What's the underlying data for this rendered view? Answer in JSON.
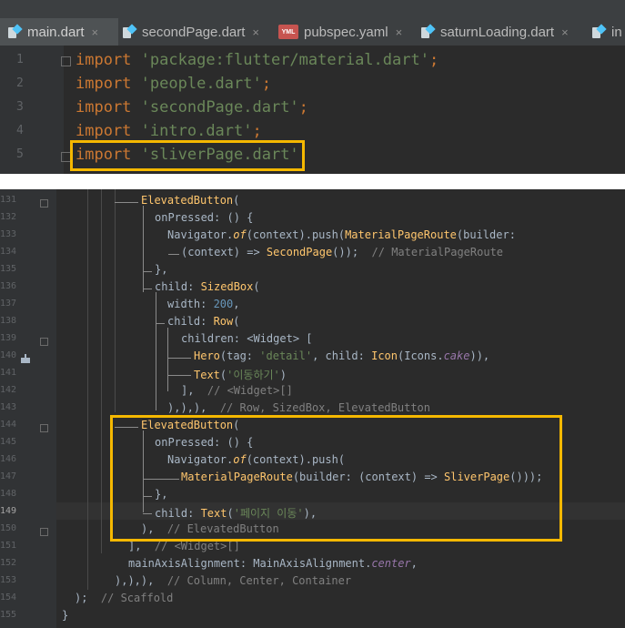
{
  "tabs": [
    {
      "label": "main.dart",
      "icon": "dart-file-icon",
      "active": true
    },
    {
      "label": "secondPage.dart",
      "icon": "dart-file-icon",
      "active": false
    },
    {
      "label": "pubspec.yaml",
      "icon": "yaml-file-icon",
      "badge": "YML",
      "active": false
    },
    {
      "label": "saturnLoading.dart",
      "icon": "dart-file-icon",
      "active": false
    },
    {
      "label": "in",
      "icon": "dart-file-icon",
      "active": false
    }
  ],
  "close_glyph": "×",
  "editor_top": {
    "line_numbers": [
      "1",
      "2",
      "3",
      "4",
      "5"
    ],
    "lines": [
      {
        "kw": "import",
        "str": "'package:flutter/material.dart'",
        "end": ";"
      },
      {
        "kw": "import",
        "str": "'people.dart'",
        "end": ";"
      },
      {
        "kw": "import",
        "str": "'secondPage.dart'",
        "end": ";"
      },
      {
        "kw": "import",
        "str": "'intro.dart'",
        "end": ";"
      },
      {
        "kw": "import",
        "str": "'sliverPage.dart'",
        "end": ";"
      }
    ]
  },
  "editor_bottom": {
    "line_numbers": [
      "131",
      "132",
      "133",
      "134",
      "135",
      "136",
      "137",
      "138",
      "139",
      "140",
      "141",
      "142",
      "143",
      "144",
      "145",
      "146",
      "147",
      "148",
      "149",
      "150",
      "151",
      "152",
      "153",
      "154",
      "155"
    ],
    "lines": {
      "l131": {
        "a": "ElevatedButton",
        "b": "("
      },
      "l132": {
        "a": "onPressed: () {"
      },
      "l133": {
        "a": "Navigator.",
        "b": "of",
        "c": "(context).push(",
        "d": "MaterialPageRoute",
        "e": "(builder:"
      },
      "l134": {
        "a": "(context) => ",
        "b": "SecondPage",
        "c": "());",
        "d": "// MaterialPageRoute"
      },
      "l135": {
        "a": "},"
      },
      "l136": {
        "a": "child: ",
        "b": "SizedBox",
        "c": "("
      },
      "l137": {
        "a": "width: ",
        "b": "200",
        "c": ","
      },
      "l138": {
        "a": "child: ",
        "b": "Row",
        "c": "("
      },
      "l139": {
        "a": "children: <Widget> ["
      },
      "l140": {
        "a": "Hero",
        "b": "(tag: ",
        "c": "'detail'",
        "d": ", child: ",
        "e": "Icon",
        "f": "(Icons.",
        "g": "cake",
        "h": ")),"
      },
      "l141": {
        "a": "Text",
        "b": "(",
        "c": "'이동하기'",
        "d": ")"
      },
      "l142": {
        "a": "],",
        "b": "// <Widget>[]"
      },
      "l143": {
        "a": "),),),",
        "b": "// Row, SizedBox, ElevatedButton"
      },
      "l144": {
        "a": "ElevatedButton",
        "b": "("
      },
      "l145": {
        "a": "onPressed: () {"
      },
      "l146": {
        "a": "Navigator.",
        "b": "of",
        "c": "(context).push("
      },
      "l147": {
        "a": "MaterialPageRoute",
        "b": "(builder: (context) => ",
        "c": "SliverPage",
        "d": "()));"
      },
      "l148": {
        "a": "},"
      },
      "l149": {
        "a": "child: ",
        "b": "Text",
        "c": "(",
        "d": "'페이지 이동'",
        "e": "),"
      },
      "l150": {
        "a": "),",
        "b": "// ElevatedButton"
      },
      "l151": {
        "a": "],",
        "b": "// <Widget>[]"
      },
      "l152": {
        "a": "mainAxisAlignment: MainAxisAlignment.",
        "b": "center",
        "c": ","
      },
      "l153": {
        "a": "),),),",
        "b": "// Column, Center, Container"
      },
      "l154": {
        "a": ");",
        "b": "// Scaffold"
      },
      "l155": {
        "a": "}"
      }
    }
  },
  "colors": {
    "keyword": "#cc7832",
    "string": "#6a8759",
    "function": "#ffc66d",
    "number": "#6897bb",
    "comment": "#808080",
    "highlight_box": "#f5b800",
    "editor_bg": "#2b2b2b"
  }
}
